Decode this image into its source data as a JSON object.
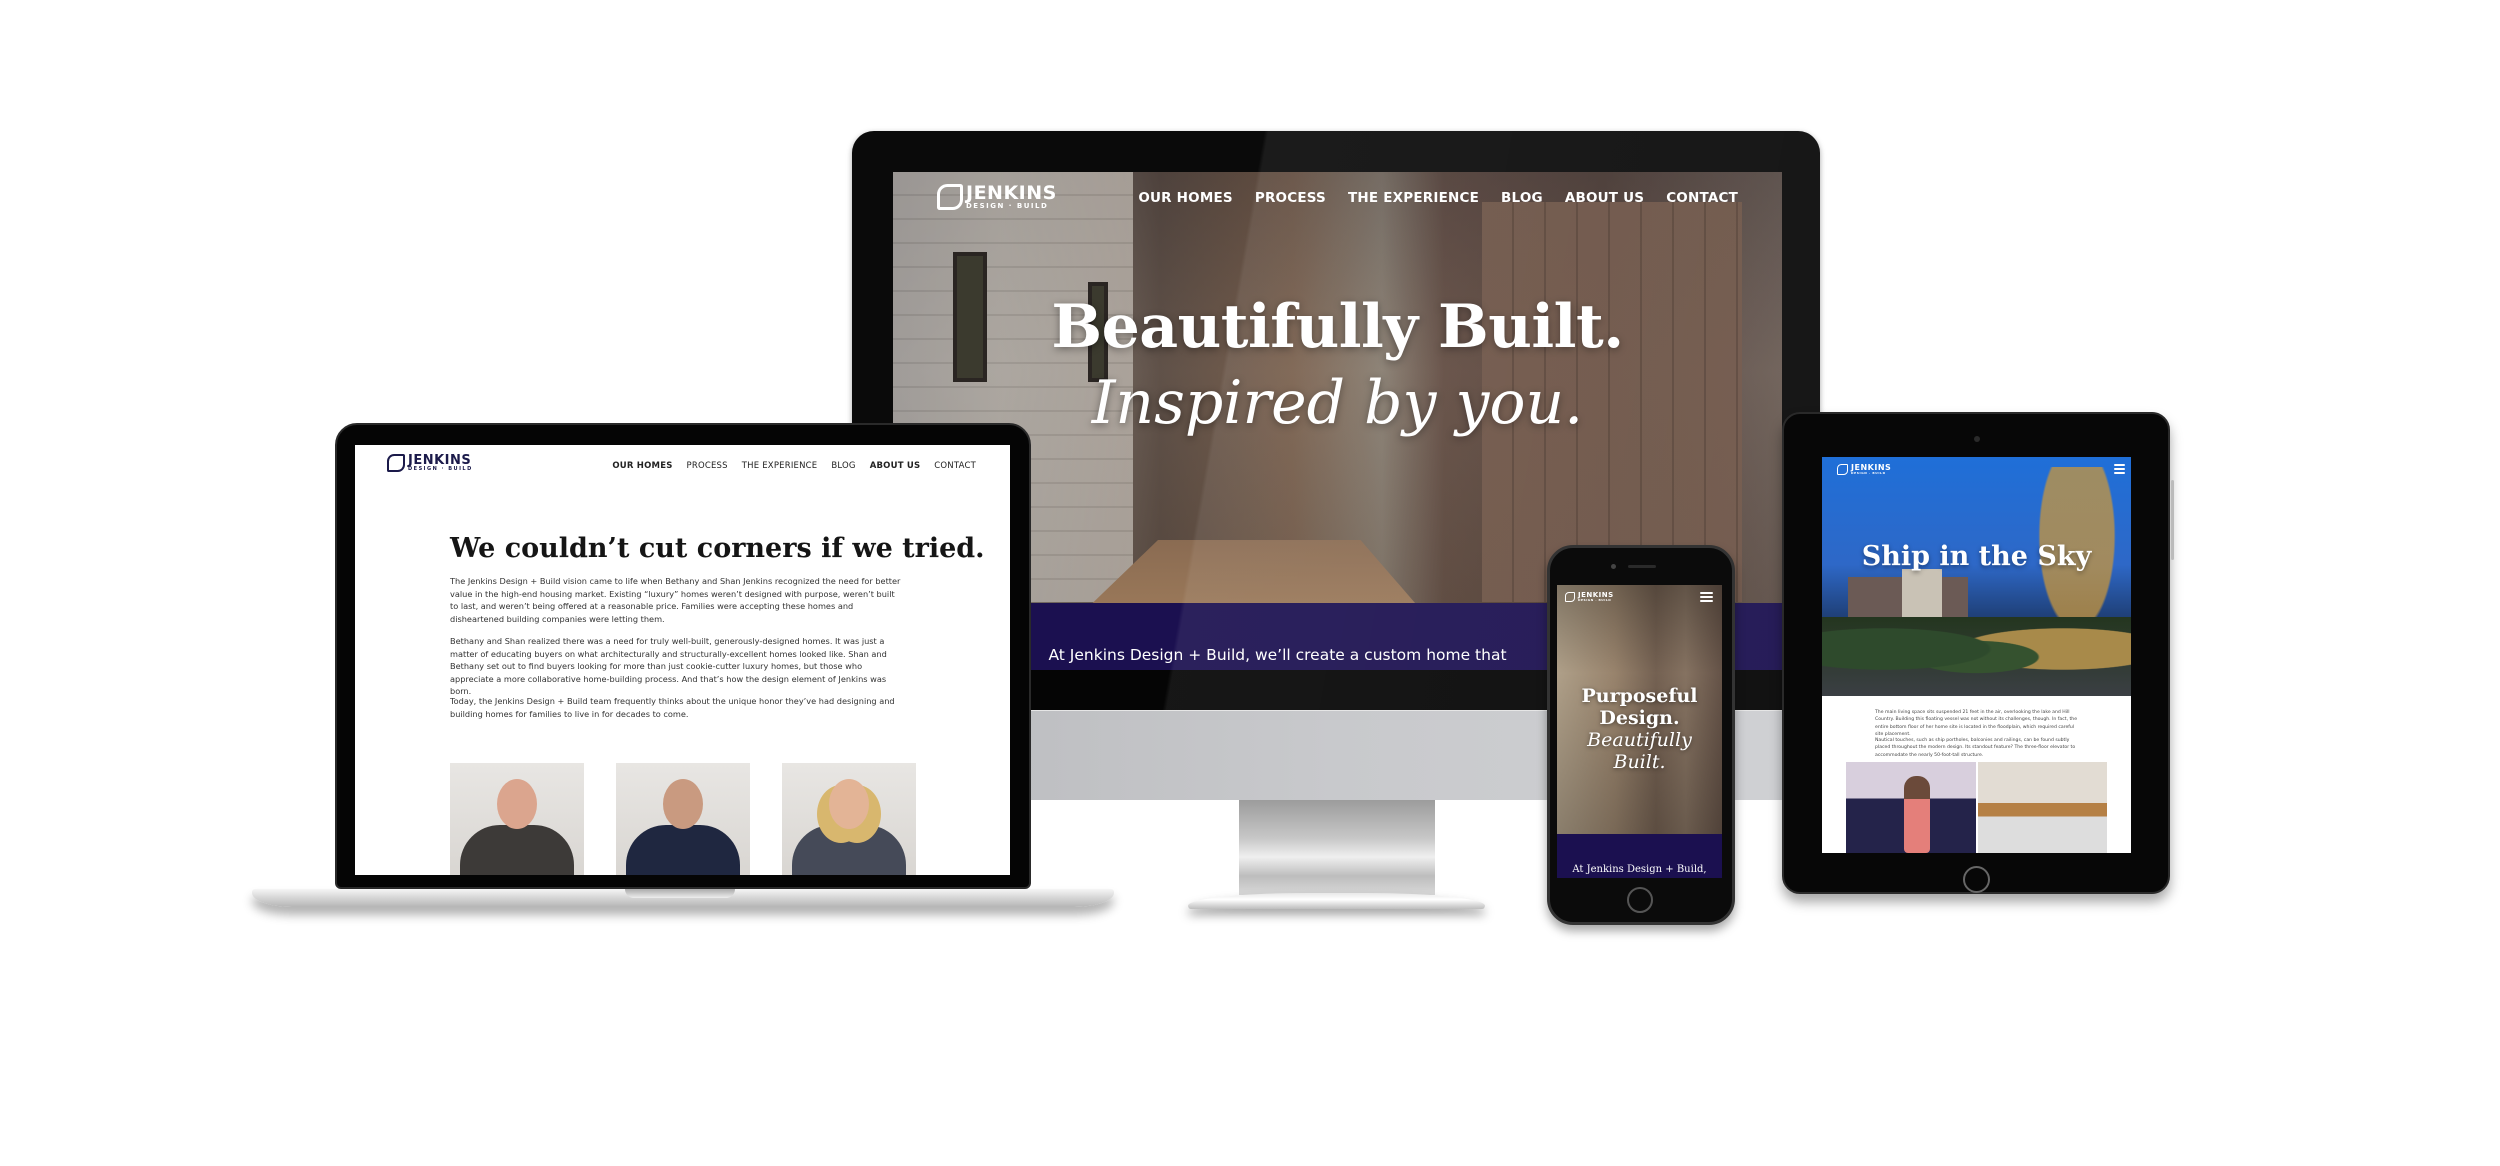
{
  "brand": {
    "logo_name": "JENKINS",
    "logo_sub": "DESIGN · BUILD",
    "accent_color": "#1b1050"
  },
  "nav": {
    "items": [
      "OUR HOMES",
      "PROCESS",
      "THE EXPERIENCE",
      "BLOG",
      "ABOUT US",
      "CONTACT"
    ]
  },
  "desktop": {
    "nav_active": "OUR HOMES",
    "hero_line1": "Beautifully Built.",
    "hero_line2": "Inspired by you.",
    "band_text": "At Jenkins Design + Build, we’ll create a custom home that"
  },
  "laptop": {
    "nav_active": "ABOUT US",
    "heading": "We couldn’t cut corners if we tried.",
    "paragraphs": [
      "The Jenkins Design + Build vision came to life when Bethany and Shan Jenkins recognized the need for better value in the high-end housing market. Existing “luxury” homes weren’t designed with purpose, weren’t built to last, and weren’t being offered at a reasonable price. Families were accepting these homes and disheartened building companies were letting them.",
      "Bethany and Shan realized there was a need for truly well-built, generously-designed homes. It was just a matter of educating buyers on what architecturally and structurally-excellent homes looked like. Shan and Bethany set out to find buyers looking for more than just cookie-cutter luxury homes, but those who appreciate a more collaborative home-building process. And that’s how the design element of Jenkins was born.",
      "Today, the Jenkins Design + Build team frequently thinks about the unique honor they’ve had designing and building homes for families to live in for decades to come."
    ],
    "team_photos": [
      "team-member-1",
      "team-member-2",
      "team-member-3"
    ]
  },
  "phone": {
    "hero_line1": "Purposeful",
    "hero_line2": "Design.",
    "hero_line3": "Beautifully",
    "hero_line4": "Built.",
    "band_text": "At Jenkins Design + Build,"
  },
  "tablet": {
    "hero_title": "Ship in the Sky",
    "paragraphs": [
      "The main living space sits suspended 21 feet in the air, overlooking the lake and Hill Country. Building this floating vessel was not without its challenges, though. In fact, the entire bottom floor of her home site is located in the floodplain, which required careful site placement.",
      "Nautical touches, such as ship portholes, balconies and railings, can be found subtly placed throughout the modern design. Its standout feature? The three-floor elevator to accommodate the nearly 50-foot-tall structure."
    ]
  }
}
